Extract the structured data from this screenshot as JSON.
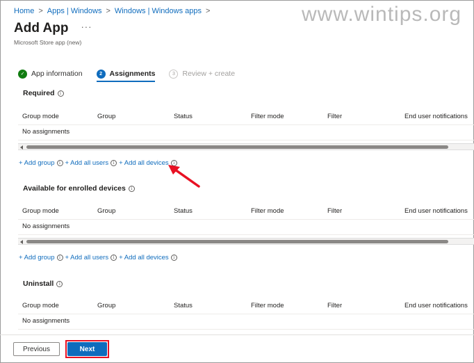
{
  "breadcrumb": [
    "Home",
    "Apps | Windows",
    "Windows | Windows apps"
  ],
  "page": {
    "title": "Add App",
    "more": "···",
    "subtitle": "Microsoft Store app (new)"
  },
  "watermark": "www.wintips.org",
  "steps": [
    {
      "label": "App information",
      "status": "done",
      "marker": "✓"
    },
    {
      "label": "Assignments",
      "status": "active",
      "marker": "2"
    },
    {
      "label": "Review + create",
      "status": "todo",
      "marker": "3"
    }
  ],
  "columns": [
    "Group mode",
    "Group",
    "Status",
    "Filter mode",
    "Filter",
    "End user notifications"
  ],
  "sections": [
    {
      "title": "Required",
      "empty": "No assignments"
    },
    {
      "title": "Available for enrolled devices",
      "empty": "No assignments"
    },
    {
      "title": "Uninstall",
      "empty": "No assignments"
    }
  ],
  "links": {
    "add_group": "+ Add group",
    "add_all_users": "+ Add all users",
    "add_all_devices": "+ Add all devices"
  },
  "info_icon": "i",
  "buttons": {
    "previous": "Previous",
    "next": "Next"
  },
  "colors": {
    "accent": "#0f6cbd",
    "done": "#107c10",
    "highlight": "#e81123"
  }
}
